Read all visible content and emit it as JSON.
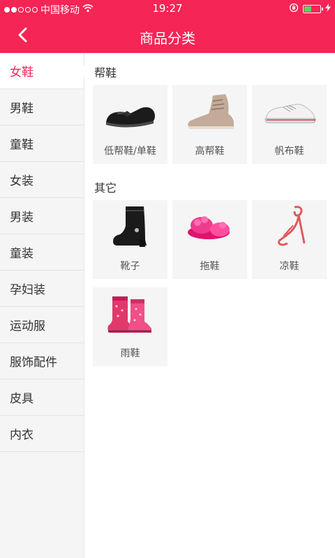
{
  "status_bar": {
    "carrier": "中国移动",
    "time": "19:27"
  },
  "header": {
    "title": "商品分类",
    "back_icon": "chevron-left-icon"
  },
  "sidebar": {
    "items": [
      {
        "label": "女鞋",
        "active": true
      },
      {
        "label": "男鞋"
      },
      {
        "label": "童鞋"
      },
      {
        "label": "女装"
      },
      {
        "label": "男装"
      },
      {
        "label": "童装"
      },
      {
        "label": "孕妇装"
      },
      {
        "label": "运动服"
      },
      {
        "label": "服饰配件"
      },
      {
        "label": "皮具"
      },
      {
        "label": "内衣"
      }
    ]
  },
  "sections": [
    {
      "title": "帮鞋",
      "items": [
        {
          "label": "低帮鞋/单鞋",
          "icon": "flat-shoe-icon"
        },
        {
          "label": "高帮鞋",
          "icon": "high-top-shoe-icon"
        },
        {
          "label": "帆布鞋",
          "icon": "canvas-shoe-icon"
        }
      ]
    },
    {
      "title": "其它",
      "items": [
        {
          "label": "靴子",
          "icon": "boot-icon"
        },
        {
          "label": "拖鞋",
          "icon": "slipper-icon"
        },
        {
          "label": "凉鞋",
          "icon": "sandal-icon"
        },
        {
          "label": "雨鞋",
          "icon": "rain-boot-icon"
        }
      ]
    }
  ],
  "colors": {
    "accent": "#f52555",
    "sidebar_bg": "#f5f5f5",
    "card_bg": "#f5f5f5"
  }
}
